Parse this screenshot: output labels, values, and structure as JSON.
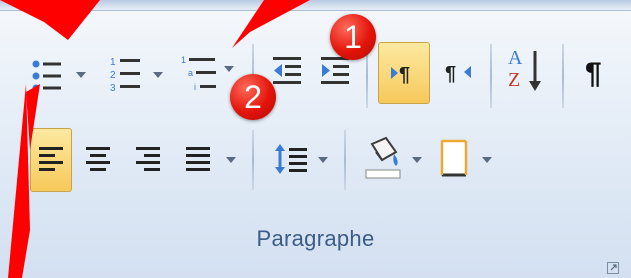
{
  "group": {
    "label": "Paragraphe"
  },
  "badges": {
    "one": "1",
    "two": "2"
  },
  "sort_glyph": {
    "top": "A",
    "bottom": "Z"
  },
  "icons": {
    "bullets": "bullet-list-icon",
    "numbering": "numbered-list-icon",
    "multilevel": "multilevel-list-icon",
    "decrease_indent": "decrease-indent-icon",
    "increase_indent": "increase-indent-icon",
    "ltr": "left-to-right-icon",
    "rtl": "right-to-left-icon",
    "sort": "sort-icon",
    "pilcrow": "show-formatting-marks-icon",
    "align_left": "align-left-icon",
    "center": "align-center-icon",
    "align_right": "align-right-icon",
    "justify": "justify-icon",
    "line_spacing": "line-spacing-icon",
    "shading": "shading-icon",
    "borders": "borders-icon",
    "launcher": "dialog-launcher-icon"
  },
  "colors": {
    "accent_active": "#f6c95b",
    "badge": "#e3140a",
    "arrow": "#ff0000",
    "label": "#3c5b85"
  }
}
